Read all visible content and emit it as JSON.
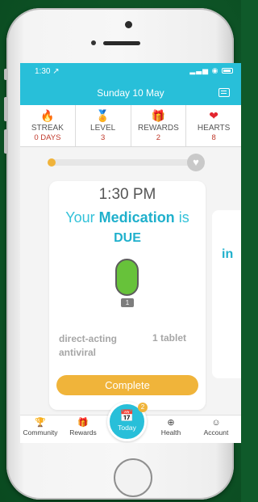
{
  "status_bar": {
    "time": "1:30 ↗"
  },
  "header": {
    "title": "Sunday 10 May",
    "message_icon": "message-icon"
  },
  "stats": [
    {
      "icon": "🔥",
      "label": "STREAK",
      "value": "0 DAYS"
    },
    {
      "icon": "🏅",
      "label": "LEVEL",
      "value": "3"
    },
    {
      "icon": "🎁",
      "label": "REWARDS",
      "value": "2"
    },
    {
      "icon": "❤",
      "label": "HEARTS",
      "value": "8"
    }
  ],
  "progress": {
    "fraction": 0.02
  },
  "card": {
    "time": "1:30 PM",
    "line_prefix": "Your ",
    "line_keyword": "Medication",
    "line_suffix": " is",
    "status": "DUE",
    "pill_count": "1",
    "drug_name": "direct-acting antiviral",
    "dose": "1 tablet",
    "complete_label": "Complete"
  },
  "next_card": {
    "partial_text": "in"
  },
  "tabs": [
    {
      "icon": "🏆",
      "label": "Community"
    },
    {
      "icon": "🎁",
      "label": "Rewards"
    },
    {
      "icon": "📅",
      "label": "Today",
      "badge": "2"
    },
    {
      "icon": "⊕",
      "label": "Health"
    },
    {
      "icon": "☺",
      "label": "Account"
    }
  ],
  "colors": {
    "accent": "#28bfd9",
    "button": "#f0b43a",
    "stat_value": "#c0392b",
    "pill": "#67c23a"
  }
}
